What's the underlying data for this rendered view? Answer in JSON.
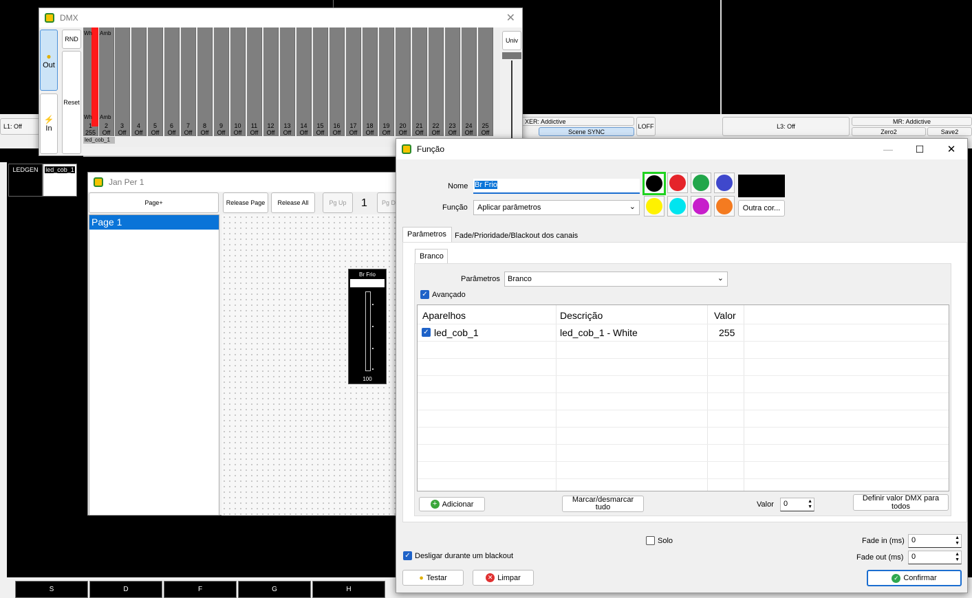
{
  "bg": {
    "l1": "L1: Off",
    "mixer": "XER: Addictive",
    "scene_sync": "Scene SYNC",
    "loff": "LOFF",
    "l3": "L3: Off",
    "mr": "MR: Addictive",
    "zero2": "Zero2",
    "save2": "Save2",
    "fixture_tabs": [
      "LEDGEN",
      "led_cob_1"
    ],
    "bottom_tabs": [
      "S",
      "D",
      "F",
      "G",
      "H"
    ]
  },
  "dmx": {
    "title": "DMX",
    "out": "Out",
    "in": "In",
    "rnd": "RND",
    "reset": "Reset",
    "univ": "Univ",
    "ch1_top": "Wh",
    "ch1_bottom": "Wh",
    "ch2_top": "Amb",
    "ch2_bottom": "Amb",
    "ch1_num": "1",
    "ch1_val": "255",
    "ch2_num": "2",
    "ch2_val": "Off",
    "off_label": "Off",
    "channels": [
      "3",
      "4",
      "5",
      "6",
      "7",
      "8",
      "9",
      "10",
      "11",
      "12",
      "13",
      "14",
      "15",
      "16",
      "17",
      "18",
      "19",
      "20",
      "21",
      "22",
      "23",
      "24",
      "25"
    ],
    "fixture_label": "led_cob_1"
  },
  "jan": {
    "title": "Jan Per 1",
    "page_plus": "Page+",
    "release_page": "Release Page",
    "release_all": "Release All",
    "pg_up": "Pg Up",
    "page_num": "1",
    "pg_down": "Pg D",
    "page_item": "Page 1",
    "fader_label": "Br Frio",
    "fader_value": "100"
  },
  "funcao": {
    "title": "Função",
    "nome_label": "Nome",
    "nome_value": "Br Frio",
    "funcao_label": "Função",
    "funcao_value": "Aplicar parâmetros",
    "outra_cor": "Outra cor...",
    "selected_color": "#000000",
    "swatches_row1": [
      "#000000",
      "#e5242a",
      "#21a64a",
      "#3f48cc"
    ],
    "swatches_row2": [
      "#fff200",
      "#00e5ef",
      "#c71ecb",
      "#f47b20"
    ],
    "tab_parametros": "Parâmetros",
    "tab_fade": "Fade/Prioridade/Blackout dos canais",
    "subtab_branco": "Branco",
    "parametros_label": "Parâmetros",
    "parametros_value": "Branco",
    "avancado": "Avançado",
    "col_aparelhos": "Aparelhos",
    "col_descricao": "Descrição",
    "col_valor": "Valor",
    "row_aparelho": "led_cob_1",
    "row_descricao": "led_cob_1 - White",
    "row_valor": "255",
    "adicionar": "Adicionar",
    "marcar": "Marcar/desmarcar tudo",
    "valor_label": "Valor",
    "valor_value": "0",
    "definir": "Definir valor DMX para todos",
    "solo": "Solo",
    "fade_in_label": "Fade in (ms)",
    "fade_in_value": "0",
    "fade_out_label": "Fade out (ms)",
    "fade_out_value": "0",
    "desligar": "Desligar durante um blackout",
    "testar": "Testar",
    "limpar": "Limpar",
    "confirmar": "Confirmar"
  }
}
